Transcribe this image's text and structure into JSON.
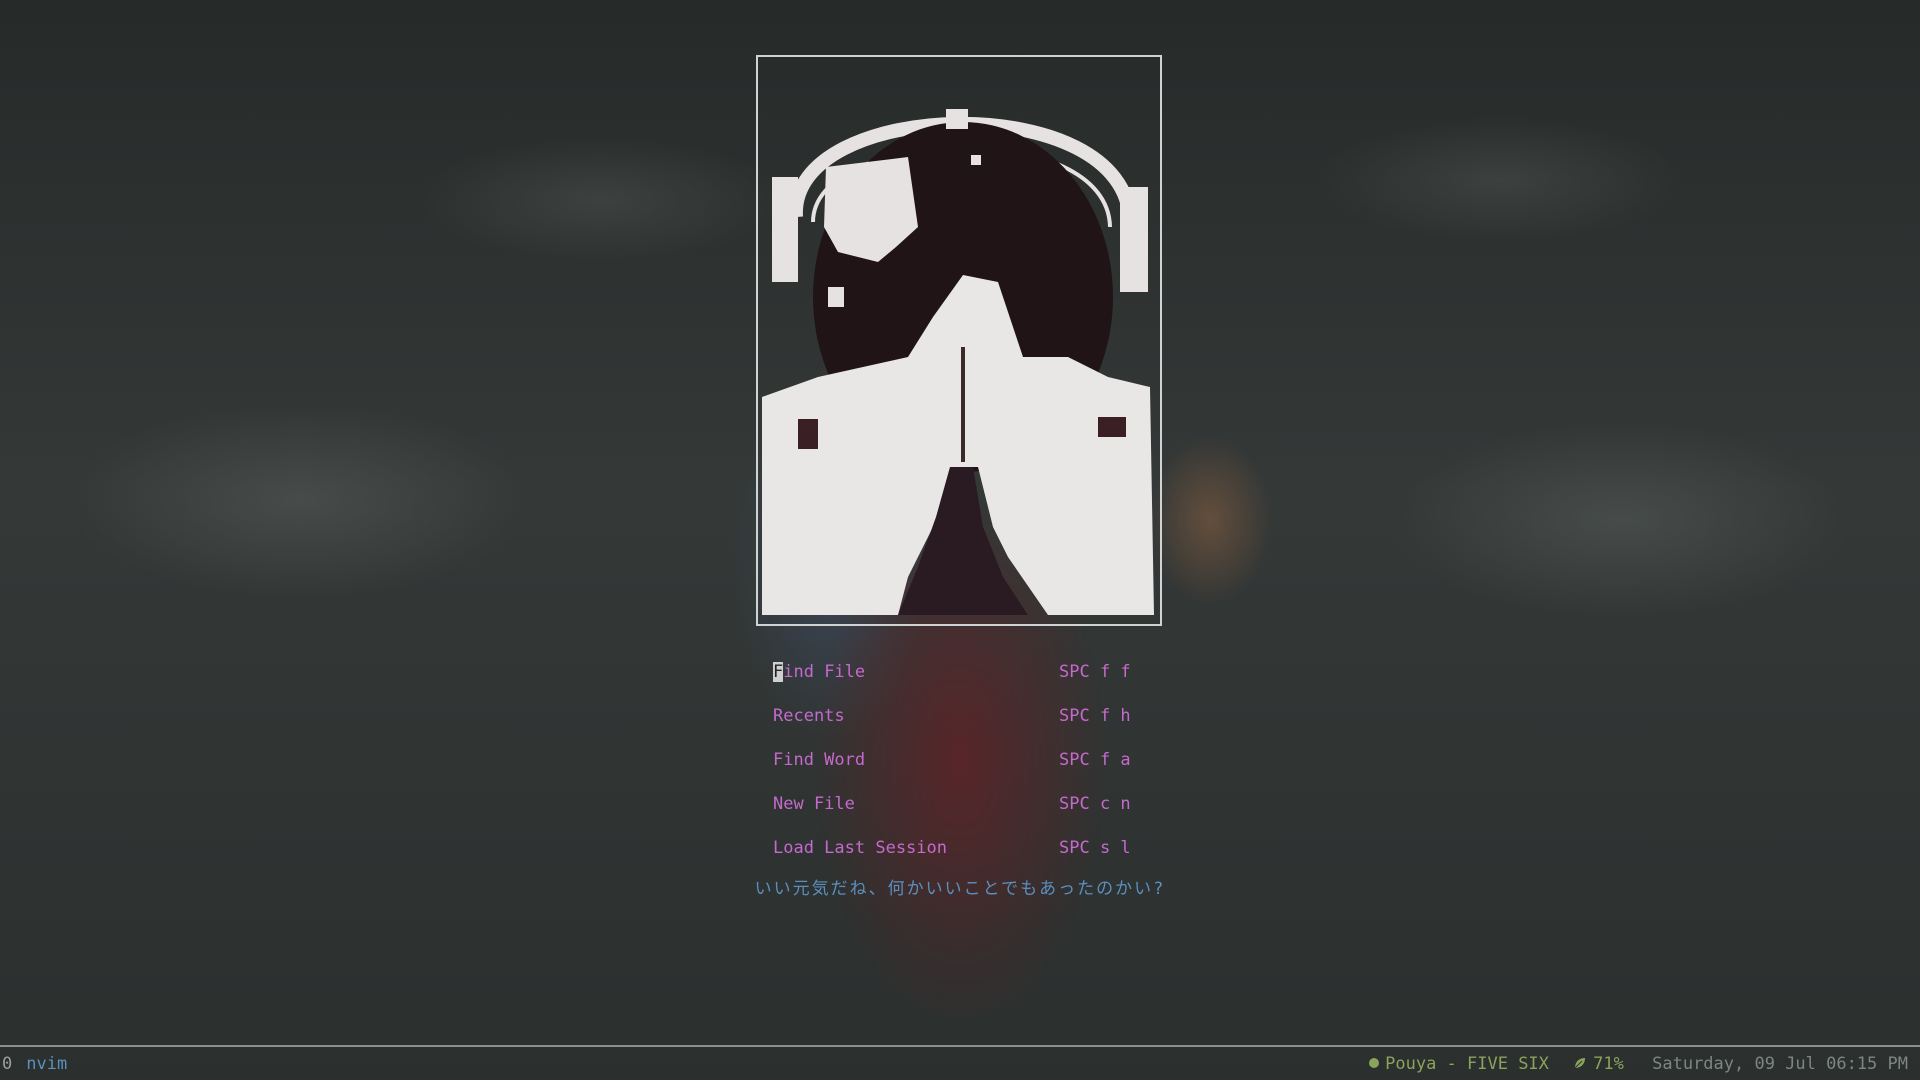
{
  "dashboard": {
    "menu": [
      {
        "label": "Find File",
        "key": "SPC f f"
      },
      {
        "label": "Recents",
        "key": "SPC f h"
      },
      {
        "label": "Find Word",
        "key": "SPC f a"
      },
      {
        "label": "New File",
        "key": "SPC c n"
      },
      {
        "label": "Load Last Session",
        "key": "SPC s l"
      }
    ],
    "quote": "いい元気だね、何かいいことでもあったのかい?"
  },
  "statusbar": {
    "window_index": "0",
    "process": "nvim",
    "music": "Pouya - FIVE SIX",
    "music_icon": "dot-icon",
    "battery": "71%",
    "battery_icon": "leaf-icon",
    "datetime": "Saturday, 09 Jul 06:15 PM"
  },
  "colors": {
    "menu_accent": "#c46acc",
    "quote_blue": "#5b8fbe",
    "status_green": "#8aa35d",
    "status_gray": "#7e8585"
  }
}
